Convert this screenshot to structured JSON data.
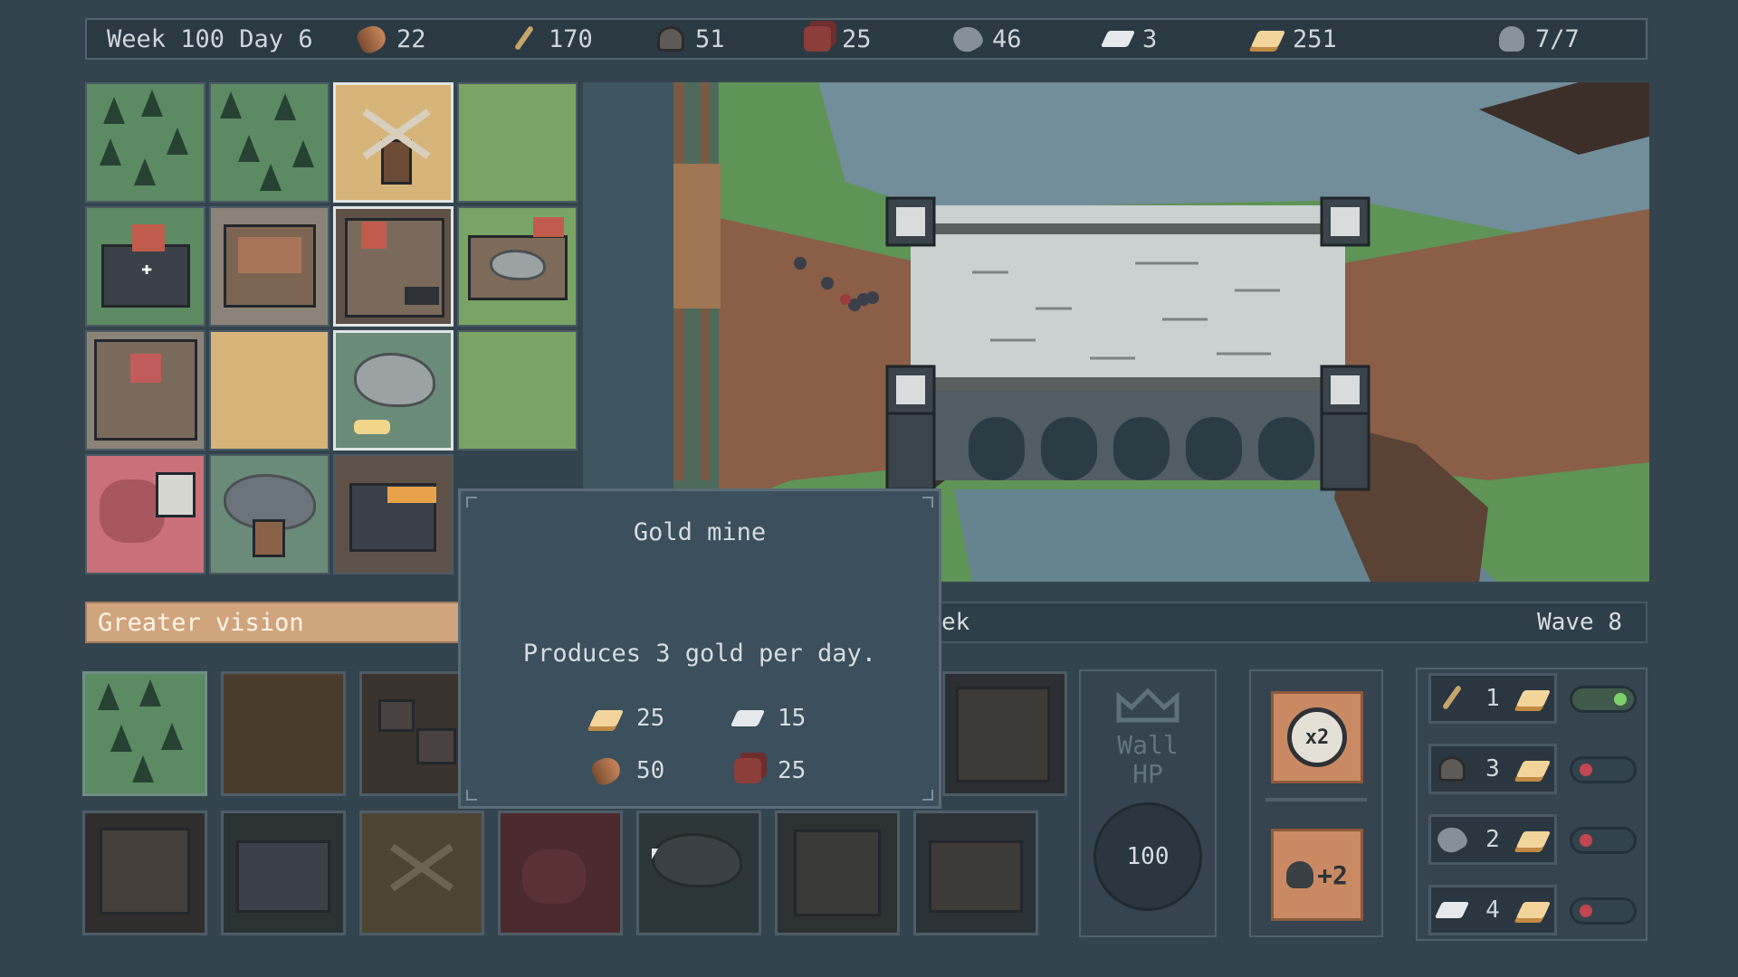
{
  "topbar": {
    "date": "Week 100 Day 6",
    "wood": "22",
    "wheat": "170",
    "stone": "51",
    "clay": "25",
    "iron": "46",
    "silver": "3",
    "gold": "251",
    "workers": "7/7"
  },
  "banner": {
    "left_text": "Greater vision",
    "mid_text_partial": "ek",
    "wave": "Wave 8"
  },
  "tooltip": {
    "title": "Gold mine",
    "description": "Produces 3 gold per day.",
    "cost": {
      "gold": "25",
      "silver": "15",
      "wood": "50",
      "clay": "25"
    }
  },
  "wall": {
    "label_line1": "Wall",
    "label_line2": "HP",
    "hp": "100"
  },
  "speed": {
    "label": "x2"
  },
  "worker_bonus": {
    "label": "+2"
  },
  "conversions": [
    {
      "from_icon": "wheat-icon",
      "amount": "1",
      "to_icon": "gold-icon",
      "enabled": true
    },
    {
      "from_icon": "stone-icon",
      "amount": "3",
      "to_icon": "gold-icon",
      "enabled": false
    },
    {
      "from_icon": "iron-icon",
      "amount": "2",
      "to_icon": "gold-icon",
      "enabled": false
    },
    {
      "from_icon": "silver-icon",
      "amount": "4",
      "to_icon": "gold-icon",
      "enabled": false
    }
  ],
  "colors": {
    "accent": "#d0a47d",
    "toggle_on": "#7fcf6a",
    "toggle_off": "#c24550"
  }
}
